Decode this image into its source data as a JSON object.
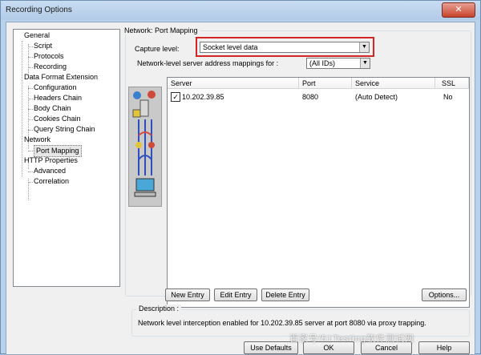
{
  "window": {
    "title": "Recording Options",
    "close_label": "✕"
  },
  "tree": {
    "items": [
      {
        "label": "General",
        "level": 0
      },
      {
        "label": "Script",
        "level": 1
      },
      {
        "label": "Protocols",
        "level": 1
      },
      {
        "label": "Recording",
        "level": 1
      },
      {
        "label": "Data Format Extension",
        "level": 0
      },
      {
        "label": "Configuration",
        "level": 1
      },
      {
        "label": "Headers Chain",
        "level": 1
      },
      {
        "label": "Body Chain",
        "level": 1
      },
      {
        "label": "Cookies Chain",
        "level": 1
      },
      {
        "label": "Query String Chain",
        "level": 1
      },
      {
        "label": "Network",
        "level": 0
      },
      {
        "label": "Port Mapping",
        "level": 1,
        "selected": true
      },
      {
        "label": "HTTP Properties",
        "level": 0
      },
      {
        "label": "Advanced",
        "level": 1
      },
      {
        "label": "Correlation",
        "level": 1
      }
    ]
  },
  "panel": {
    "group_title": "Network: Port Mapping",
    "capture_level_label": "Capture level:",
    "capture_level_value": "Socket level data",
    "mapping_label": "Network-level server address mappings for :",
    "mapping_value": "(All IDs)"
  },
  "table": {
    "columns": [
      "Server",
      "Port",
      "Service",
      "SSL"
    ],
    "rows": [
      {
        "checked": true,
        "server": "10.202.39.85",
        "port": "8080",
        "service": "(Auto Detect)",
        "ssl": "No"
      }
    ]
  },
  "buttons": {
    "new_entry": "New Entry",
    "edit_entry": "Edit Entry",
    "delete_entry": "Delete Entry",
    "options": "Options...",
    "use_defaults": "Use Defaults",
    "ok": "OK",
    "cancel": "Cancel",
    "help": "Help"
  },
  "description": {
    "label": "Description :",
    "text": "Network level interception enabled for 10.202.39.85 server at port 8080 via proxy trapping."
  },
  "watermark": "百家号/51Testing软件测试网",
  "colors": {
    "highlight": "#d42626",
    "window_frame": "#b9d1ea",
    "dialog_bg": "#f0f0f0"
  }
}
